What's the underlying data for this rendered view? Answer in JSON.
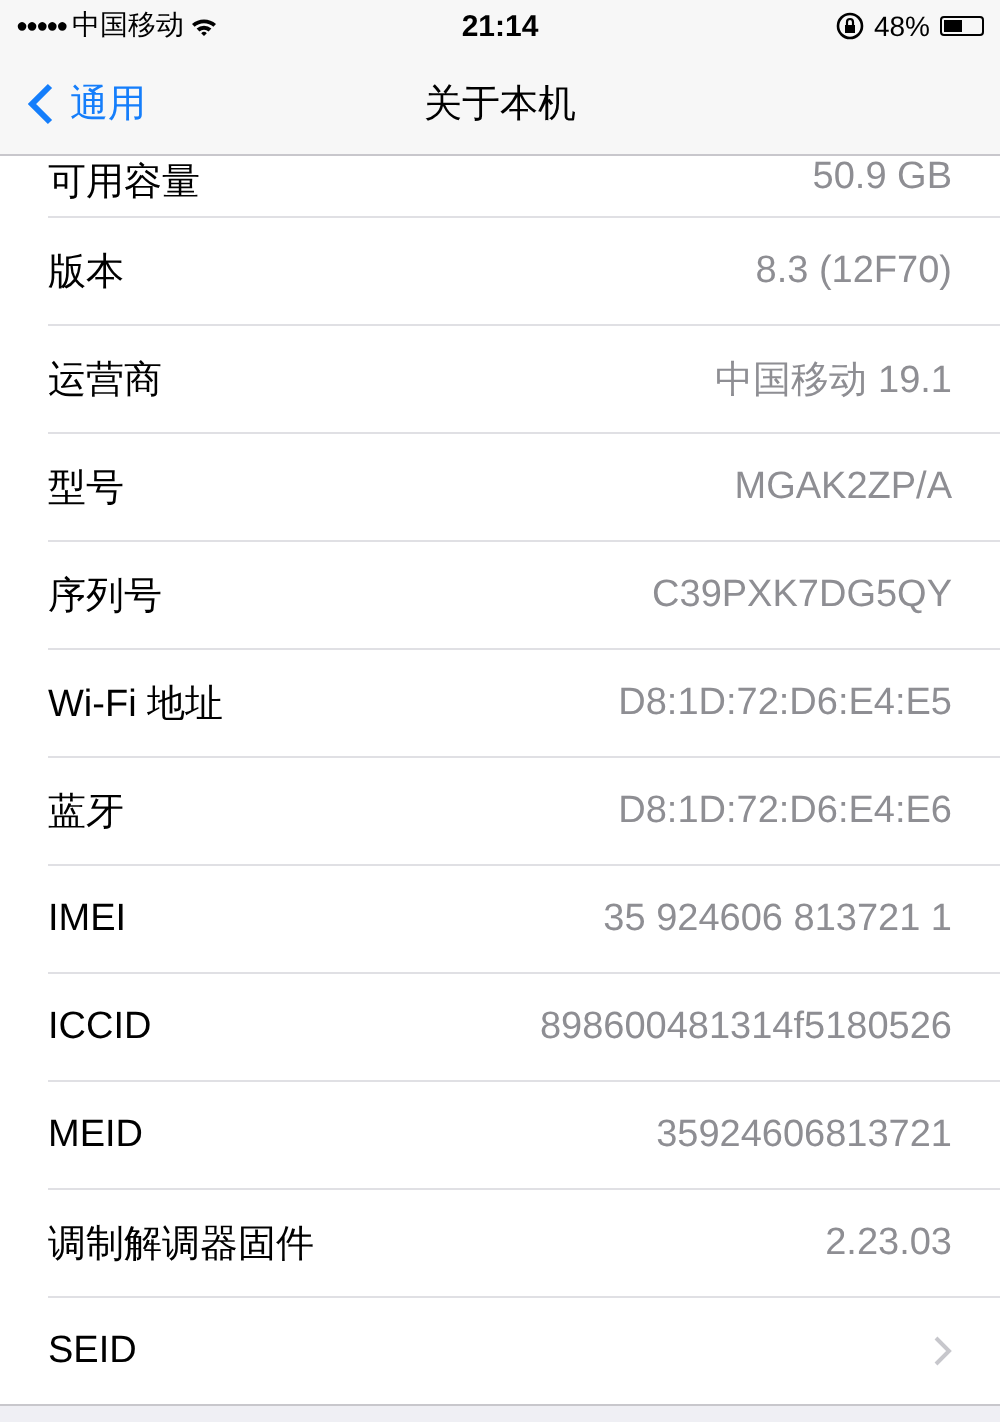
{
  "status_bar": {
    "signal": "●●●●●",
    "carrier": "中国移动",
    "time": "21:14",
    "battery_percent": "48%"
  },
  "nav_bar": {
    "back": "通用",
    "title": "关于本机"
  },
  "rows": [
    {
      "kind": "value",
      "label": "可用容量",
      "value": "50.9 GB"
    },
    {
      "kind": "value",
      "label": "版本",
      "value": "8.3 (12F70)"
    },
    {
      "kind": "value",
      "label": "运营商",
      "value": "中国移动 19.1"
    },
    {
      "kind": "value",
      "label": "型号",
      "value": "MGAK2ZP/A"
    },
    {
      "kind": "value",
      "label": "序列号",
      "value": "C39PXK7DG5QY"
    },
    {
      "kind": "value",
      "label": "Wi-Fi 地址",
      "value": "D8:1D:72:D6:E4:E5"
    },
    {
      "kind": "value",
      "label": "蓝牙",
      "value": "D8:1D:72:D6:E4:E6"
    },
    {
      "kind": "value",
      "label": "IMEI",
      "value": "35 924606 813721 1"
    },
    {
      "kind": "value",
      "label": "ICCID",
      "value": "898600481314f5180526"
    },
    {
      "kind": "value",
      "label": "MEID",
      "value": "35924606813721"
    },
    {
      "kind": "value",
      "label": "调制解调器固件",
      "value": "2.23.03"
    },
    {
      "kind": "disclosure",
      "label": "SEID"
    }
  ]
}
